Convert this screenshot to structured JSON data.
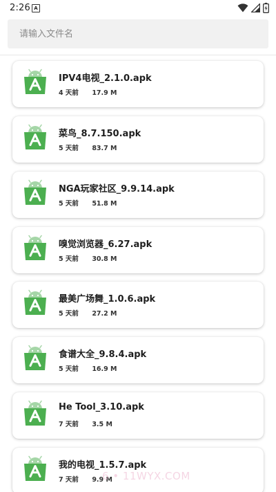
{
  "status_bar": {
    "time": "2:26",
    "notification_letter": "A",
    "icons": [
      "wifi-icon",
      "signal-icon",
      "battery-icon"
    ]
  },
  "search": {
    "placeholder": "请输入文件名",
    "value": ""
  },
  "files": [
    {
      "name": "IPV4电视_2.1.0.apk",
      "time": "4 天前",
      "size": "17.9 M"
    },
    {
      "name": "菜鸟_8.7.150.apk",
      "time": "5 天前",
      "size": "83.7 M"
    },
    {
      "name": "NGA玩家社区_9.9.14.apk",
      "time": "5 天前",
      "size": "51.8 M"
    },
    {
      "name": "嗅觉浏览器_6.27.apk",
      "time": "5 天前",
      "size": "30.8 M"
    },
    {
      "name": "最美广场舞_1.0.6.apk",
      "time": "5 天前",
      "size": "27.2 M"
    },
    {
      "name": "食谱大全_9.8.4.apk",
      "time": "5 天前",
      "size": "16.9 M"
    },
    {
      "name": "He Tool_3.10.apk",
      "time": "7 天前",
      "size": "3.5 M"
    },
    {
      "name": "我的电视_1.5.7.apk",
      "time": "7 天前",
      "size": "9.9 M"
    }
  ],
  "watermark": "6 • 11WYX.COM",
  "colors": {
    "apk_icon_green": "#4caf50",
    "apk_icon_android": "#a5d6a7"
  }
}
